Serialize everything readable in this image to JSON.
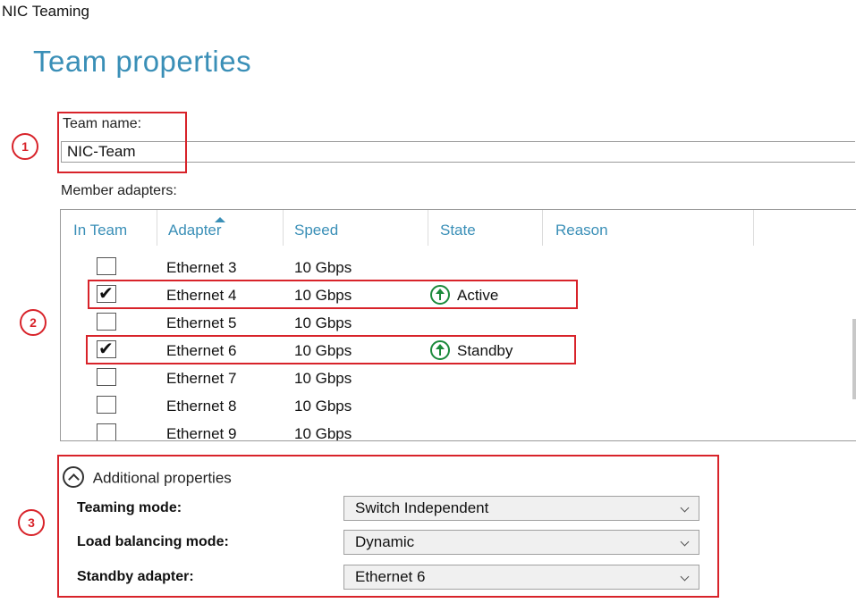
{
  "window": {
    "title": "NIC Teaming"
  },
  "page": {
    "title": "Team properties"
  },
  "team_name": {
    "label": "Team name:",
    "value": "NIC-Team"
  },
  "members": {
    "label": "Member adapters:",
    "columns": [
      "In Team",
      "Adapter",
      "Speed",
      "State",
      "Reason"
    ],
    "rows": [
      {
        "checked": false,
        "adapter": "Ethernet 3",
        "speed": "10 Gbps",
        "state": "",
        "reason": ""
      },
      {
        "checked": true,
        "adapter": "Ethernet 4",
        "speed": "10 Gbps",
        "state": "Active",
        "reason": ""
      },
      {
        "checked": false,
        "adapter": "Ethernet 5",
        "speed": "10 Gbps",
        "state": "",
        "reason": ""
      },
      {
        "checked": true,
        "adapter": "Ethernet 6",
        "speed": "10 Gbps",
        "state": "Standby",
        "reason": ""
      },
      {
        "checked": false,
        "adapter": "Ethernet 7",
        "speed": "10 Gbps",
        "state": "",
        "reason": ""
      },
      {
        "checked": false,
        "adapter": "Ethernet 8",
        "speed": "10 Gbps",
        "state": "",
        "reason": ""
      },
      {
        "checked": false,
        "adapter": "Ethernet 9",
        "speed": "10 Gbps",
        "state": "",
        "reason": ""
      }
    ],
    "check_glyph": "✔"
  },
  "additional": {
    "toggle_label": "Additional properties",
    "teaming_mode": {
      "label": "Teaming mode:",
      "value": "Switch Independent"
    },
    "load_balancing": {
      "label": "Load balancing mode:",
      "value": "Dynamic"
    },
    "standby_adapter": {
      "label": "Standby adapter:",
      "value": "Ethernet 6"
    }
  },
  "annotations": {
    "m1": "1",
    "m2": "2",
    "m3": "3"
  },
  "colors": {
    "accent": "#3a8fb7",
    "highlight": "#d8232a",
    "state_ok": "#1b8a3b"
  },
  "icons": {
    "state": "arrow-up-circle-icon",
    "toggle": "chevron-up-circle-icon",
    "dropdown": "chevron-down-icon"
  }
}
